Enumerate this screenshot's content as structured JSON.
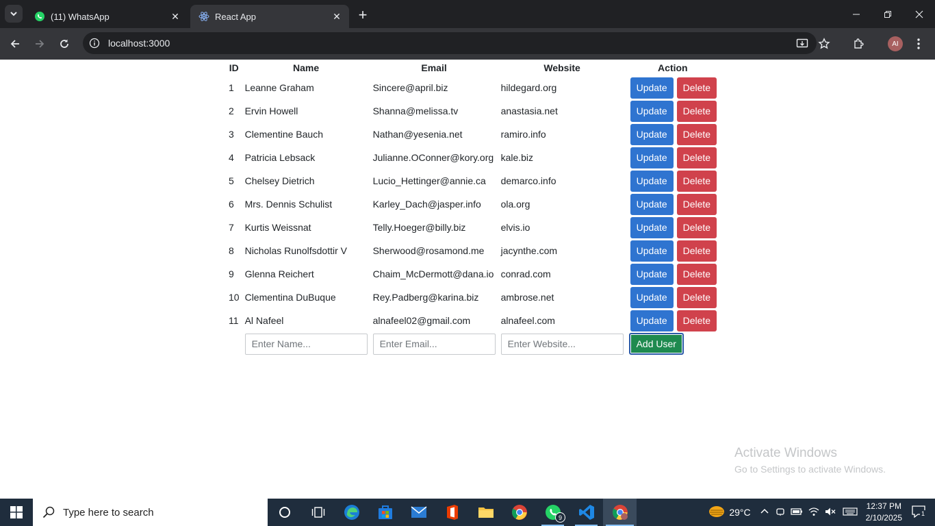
{
  "browser": {
    "tabs": [
      {
        "title": "(11) WhatsApp",
        "active": false
      },
      {
        "title": "React App",
        "active": true
      }
    ],
    "url": "localhost:3000",
    "profile_initials": "AI"
  },
  "table": {
    "headers": {
      "id": "ID",
      "name": "Name",
      "email": "Email",
      "website": "Website",
      "action": "Action"
    },
    "rows": [
      {
        "id": "1",
        "name": "Leanne Graham",
        "email": "Sincere@april.biz",
        "website": "hildegard.org"
      },
      {
        "id": "2",
        "name": "Ervin Howell",
        "email": "Shanna@melissa.tv",
        "website": "anastasia.net"
      },
      {
        "id": "3",
        "name": "Clementine Bauch",
        "email": "Nathan@yesenia.net",
        "website": "ramiro.info"
      },
      {
        "id": "4",
        "name": "Patricia Lebsack",
        "email": "Julianne.OConner@kory.org",
        "website": "kale.biz"
      },
      {
        "id": "5",
        "name": "Chelsey Dietrich",
        "email": "Lucio_Hettinger@annie.ca",
        "website": "demarco.info"
      },
      {
        "id": "6",
        "name": "Mrs. Dennis Schulist",
        "email": "Karley_Dach@jasper.info",
        "website": "ola.org"
      },
      {
        "id": "7",
        "name": "Kurtis Weissnat",
        "email": "Telly.Hoeger@billy.biz",
        "website": "elvis.io"
      },
      {
        "id": "8",
        "name": "Nicholas Runolfsdottir V",
        "email": "Sherwood@rosamond.me",
        "website": "jacynthe.com"
      },
      {
        "id": "9",
        "name": "Glenna Reichert",
        "email": "Chaim_McDermott@dana.io",
        "website": "conrad.com"
      },
      {
        "id": "10",
        "name": "Clementina DuBuque",
        "email": "Rey.Padberg@karina.biz",
        "website": "ambrose.net"
      },
      {
        "id": "11",
        "name": "Al Nafeel",
        "email": "alnafeel02@gmail.com",
        "website": "alnafeel.com"
      }
    ],
    "update_label": "Update",
    "delete_label": "Delete"
  },
  "form": {
    "name_placeholder": "Enter Name...",
    "email_placeholder": "Enter Email...",
    "website_placeholder": "Enter Website...",
    "add_label": "Add User"
  },
  "watermark": {
    "line1": "Activate Windows",
    "line2": "Go to Settings to activate Windows."
  },
  "taskbar": {
    "search_placeholder": "Type here to search",
    "whatsapp_badge": "9",
    "temperature": "29°C",
    "time": "12:37 PM",
    "date": "2/10/2025",
    "notification_count": "1"
  },
  "colors": {
    "update": "#2f74d0",
    "delete": "#d0424c",
    "add": "#1e8a4f"
  }
}
